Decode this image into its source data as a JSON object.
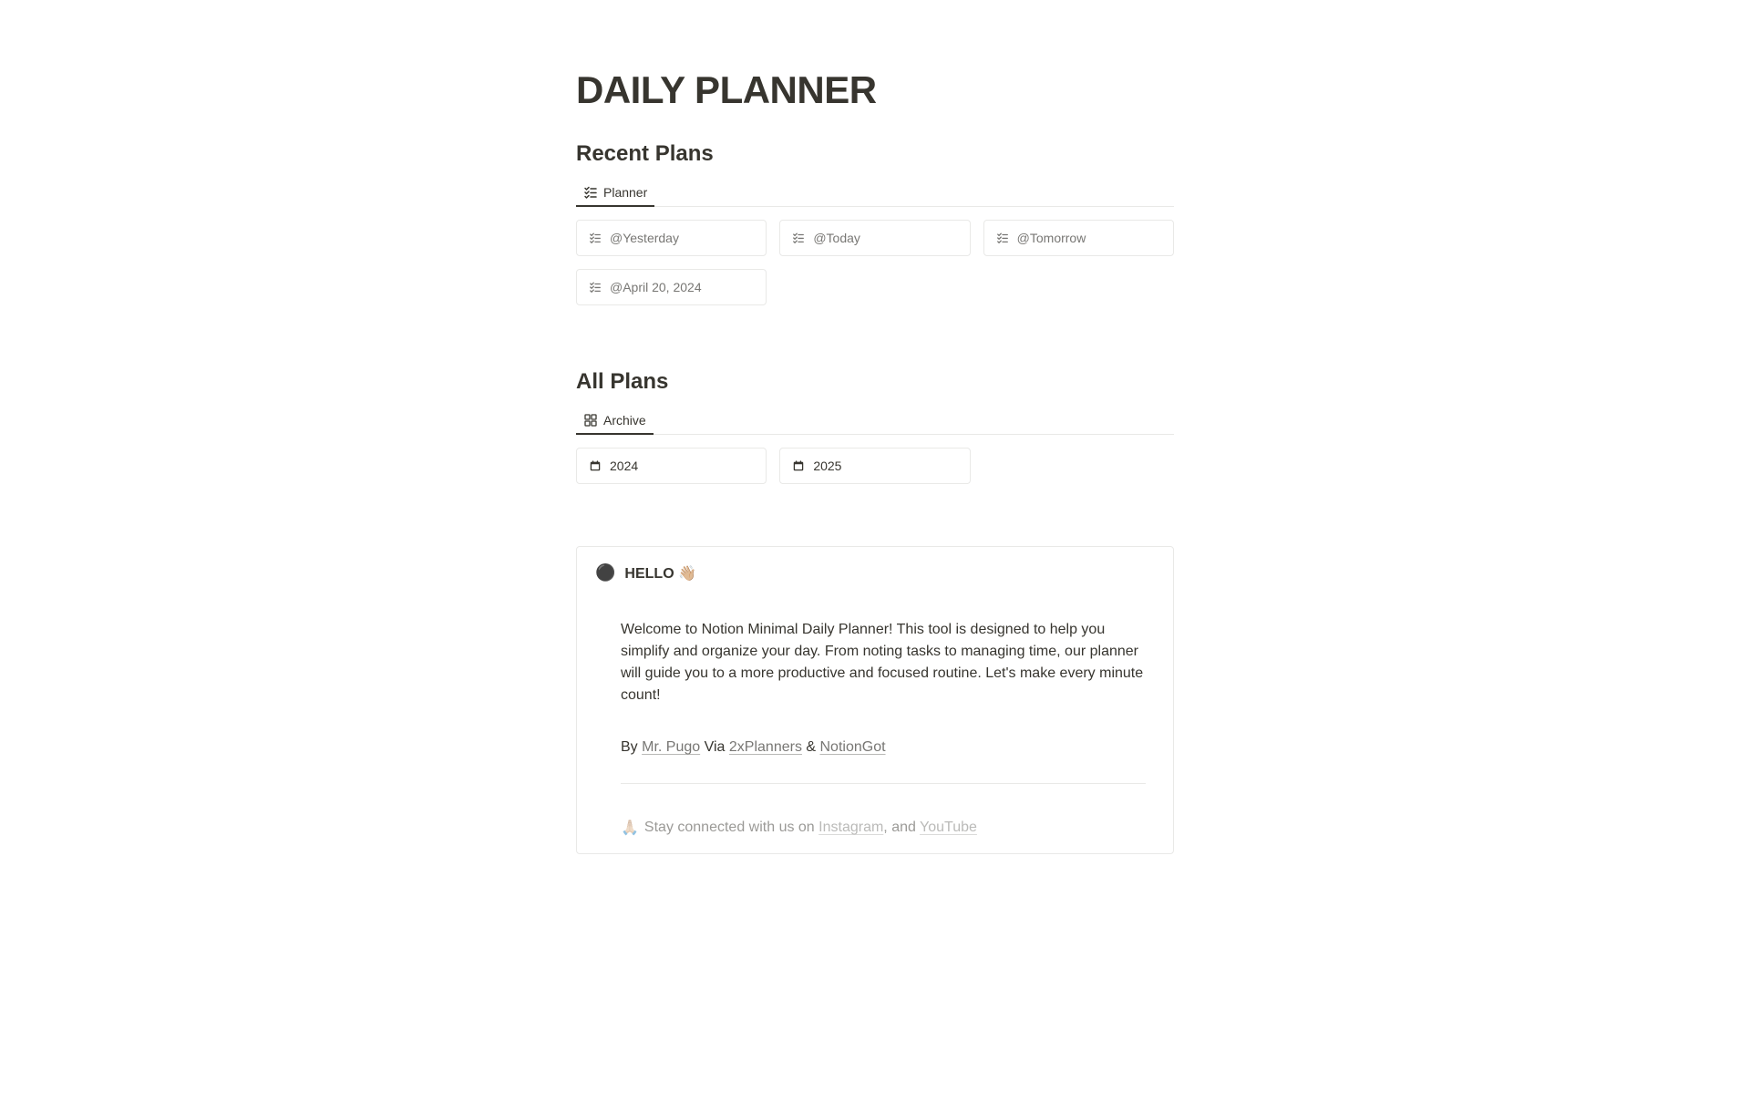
{
  "title": "DAILY PLANNER",
  "recent": {
    "heading": "Recent Plans",
    "tab": "Planner",
    "cards": [
      {
        "label": "@Yesterday"
      },
      {
        "label": "@Today"
      },
      {
        "label": "@Tomorrow"
      },
      {
        "label": "@April 20, 2024"
      }
    ]
  },
  "all": {
    "heading": "All Plans",
    "tab": "Archive",
    "cards": [
      {
        "label": "2024"
      },
      {
        "label": "2025"
      }
    ]
  },
  "callout": {
    "emoji": "⚫",
    "title": "HELLO 👋🏼",
    "welcome": "Welcome to Notion Minimal Daily Planner! This tool is designed to help you simplify and organize your day. From noting tasks to managing time, our planner will guide you to a more productive and focused routine. Let's make every minute count!",
    "by": "By ",
    "author": "Mr. Pugo",
    "via": " Via ",
    "link1": "2xPlanners",
    "amp": " & ",
    "link2": "NotionGot",
    "social_emoji": "🙏🏼",
    "social_text": "Stay connected with us on ",
    "social_link1": "Instagram",
    "social_comma": ", and ",
    "social_link2": "YouTube"
  }
}
